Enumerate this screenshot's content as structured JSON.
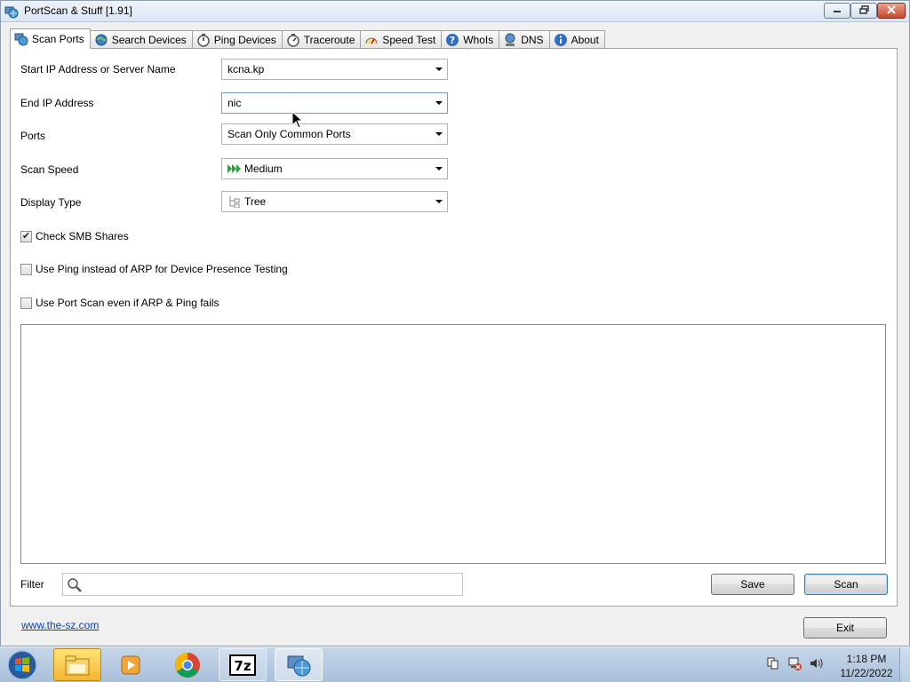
{
  "window": {
    "title": "PortScan & Stuff [1.91]",
    "controls": {
      "minimize_icon": "minimize-icon",
      "maximize_icon": "restore-icon",
      "close_icon": "close-icon"
    }
  },
  "tabs": [
    {
      "label": "Scan Ports",
      "icon": "scan-ports-icon",
      "active": true
    },
    {
      "label": "Search Devices",
      "icon": "globe-icon"
    },
    {
      "label": "Ping Devices",
      "icon": "stopwatch-icon"
    },
    {
      "label": "Traceroute",
      "icon": "stopwatch-icon"
    },
    {
      "label": "Speed Test",
      "icon": "speedometer-icon"
    },
    {
      "label": "WhoIs",
      "icon": "help-icon"
    },
    {
      "label": "DNS",
      "icon": "network-icon"
    },
    {
      "label": "About",
      "icon": "info-icon"
    }
  ],
  "form": {
    "start_ip": {
      "label": "Start IP Address or Server Name",
      "value": "kcna.kp"
    },
    "end_ip": {
      "label": "End IP Address",
      "value": "nic"
    },
    "ports": {
      "label": "Ports",
      "value": "Scan Only Common Ports"
    },
    "scan_speed": {
      "label": "Scan Speed",
      "value": "Medium",
      "icon": "fast-forward-icon"
    },
    "display_type": {
      "label": "Display Type",
      "value": "Tree",
      "icon": "tree-icon"
    }
  },
  "checkboxes": {
    "smb": {
      "label": "Check SMB Shares",
      "checked": true
    },
    "ping": {
      "label": "Use Ping instead of ARP for Device Presence Testing",
      "checked": false
    },
    "portscan": {
      "label": "Use Port Scan even if ARP & Ping fails",
      "checked": false
    }
  },
  "filter": {
    "label": "Filter",
    "value": "",
    "icon": "search-icon"
  },
  "buttons": {
    "save": "Save",
    "scan": "Scan",
    "exit": "Exit"
  },
  "link": "www.the-sz.com",
  "taskbar": {
    "clock_time": "1:18 PM",
    "clock_date": "11/22/2022",
    "apps": [
      "file-explorer-icon",
      "media-player-icon",
      "chrome-icon",
      "7zip-icon",
      "portscan-icon"
    ]
  },
  "colors": {
    "accent": "#3c7fb1",
    "link": "#0645ad",
    "speed_icon": "#2e9e3e"
  }
}
